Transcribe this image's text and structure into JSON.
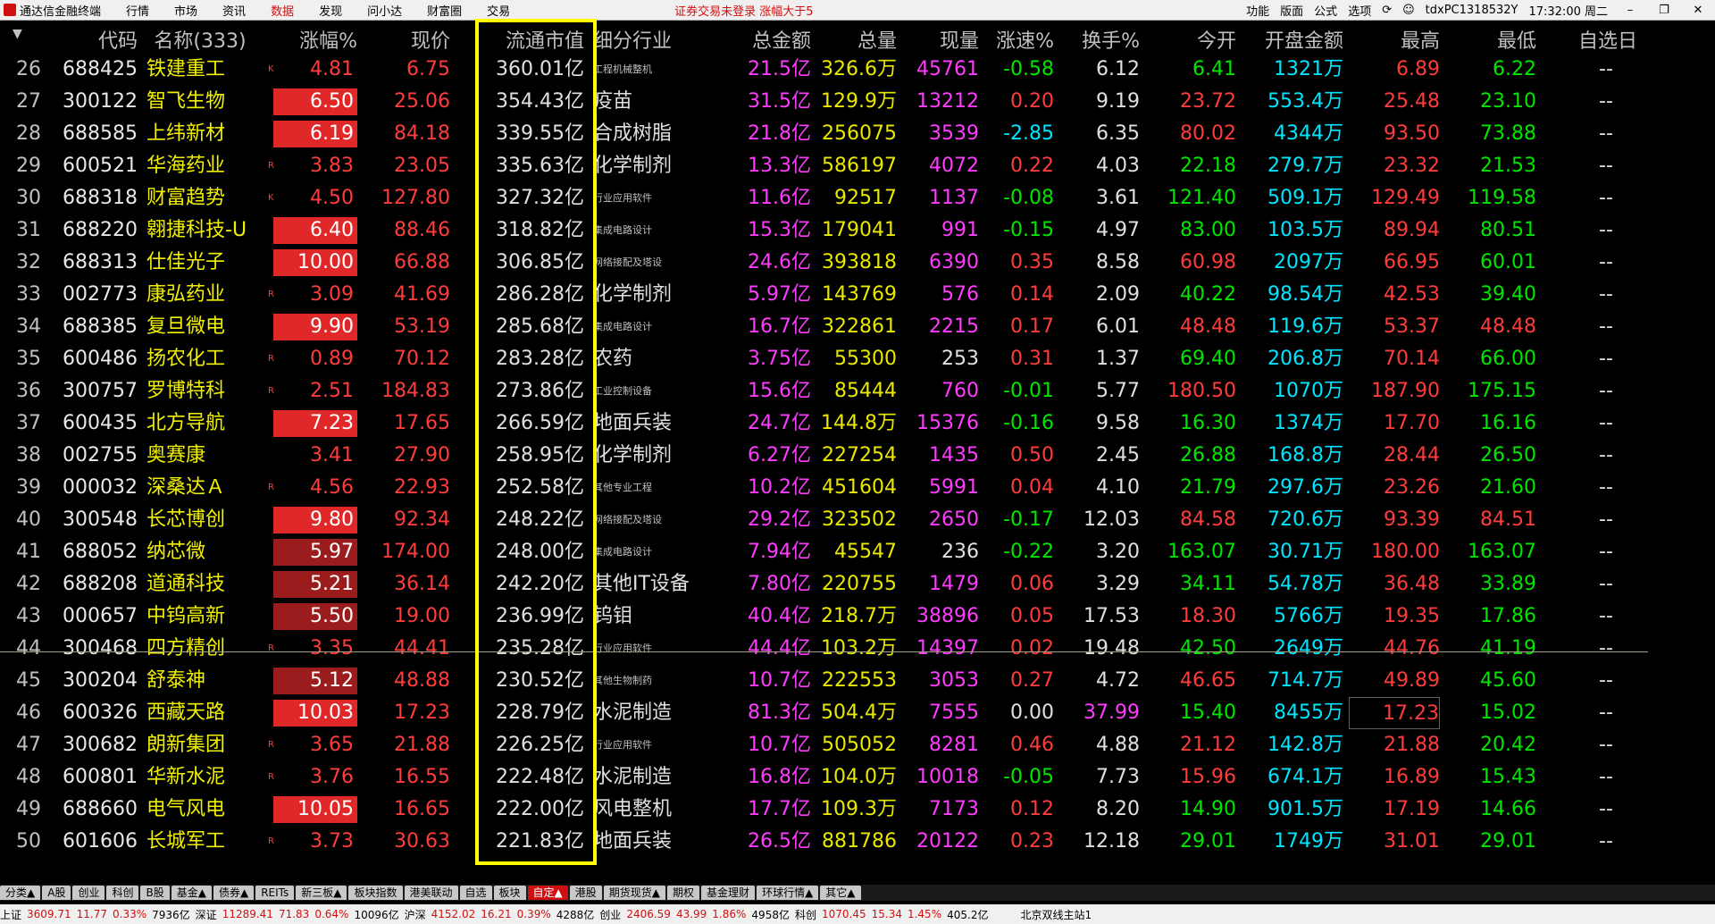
{
  "topbar": {
    "app_title": "通达信金融终端",
    "menus": [
      "行情",
      "市场",
      "资讯",
      "数据",
      "发现",
      "问小达",
      "财富圈",
      "交易"
    ],
    "active_menu": "数据",
    "notice": "证券交易未登录  涨幅大于5",
    "right_items": [
      "功能",
      "版面",
      "公式",
      "选项"
    ],
    "user": "tdxPC1318532Y",
    "time": "17:32:00 周二"
  },
  "headers": [
    "代码",
    "名称(333)",
    "涨幅%",
    "现价",
    "流通市值",
    "细分行业",
    "总金额",
    "总量",
    "现量",
    "涨速%",
    "换手%",
    "今开",
    "开盘金额",
    "最高",
    "最低",
    "自选日"
  ],
  "rows": [
    {
      "idx": "26",
      "code": "688425",
      "name": "铁建重工",
      "mark": "K",
      "pct": "4.81",
      "box": "",
      "price": "6.75",
      "cap": "360.01亿",
      "ind": "工程机械整机",
      "ind_small": true,
      "amt": "21.5亿",
      "vol": "326.6万",
      "cur": "45761",
      "curc": "magenta",
      "spd": "-0.58",
      "spdc": "green",
      "turn": "6.12",
      "open": "6.41",
      "openc": "green",
      "oamt": "1321万",
      "high": "6.89",
      "low": "6.22",
      "lowc": "green",
      "sel": "--"
    },
    {
      "idx": "27",
      "code": "300122",
      "name": "智飞生物",
      "mark": "",
      "pct": "6.50",
      "box": "bright",
      "price": "25.06",
      "cap": "354.43亿",
      "ind": "疫苗",
      "ind_small": false,
      "amt": "31.5亿",
      "vol": "129.9万",
      "cur": "13212",
      "curc": "magenta",
      "spd": "0.20",
      "spdc": "red",
      "turn": "9.19",
      "open": "23.72",
      "openc": "red",
      "oamt": "553.4万",
      "high": "25.48",
      "low": "23.10",
      "lowc": "green",
      "sel": "--"
    },
    {
      "idx": "28",
      "code": "688585",
      "name": "上纬新材",
      "mark": "",
      "pct": "6.19",
      "box": "bright",
      "price": "84.18",
      "cap": "339.55亿",
      "ind": "合成树脂",
      "ind_small": false,
      "amt": "21.8亿",
      "vol": "256075",
      "cur": "3539",
      "curc": "magenta",
      "spd": "-2.85",
      "spdc": "cyan",
      "turn": "6.35",
      "open": "80.02",
      "openc": "red",
      "oamt": "4344万",
      "high": "93.50",
      "low": "73.88",
      "lowc": "green",
      "sel": "--"
    },
    {
      "idx": "29",
      "code": "600521",
      "name": "华海药业",
      "mark": "R",
      "pct": "3.83",
      "box": "",
      "price": "23.05",
      "cap": "335.63亿",
      "ind": "化学制剂",
      "ind_small": false,
      "amt": "13.3亿",
      "vol": "586197",
      "cur": "4072",
      "curc": "magenta",
      "spd": "0.22",
      "spdc": "red",
      "turn": "4.03",
      "open": "22.18",
      "openc": "green",
      "oamt": "279.7万",
      "high": "23.32",
      "low": "21.53",
      "lowc": "green",
      "sel": "--"
    },
    {
      "idx": "30",
      "code": "688318",
      "name": "财富趋势",
      "mark": "K",
      "pct": "4.50",
      "box": "",
      "price": "127.80",
      "cap": "327.32亿",
      "ind": "行业应用软件",
      "ind_small": true,
      "amt": "11.6亿",
      "vol": "92517",
      "cur": "1137",
      "curc": "magenta",
      "spd": "-0.08",
      "spdc": "green",
      "turn": "3.61",
      "open": "121.40",
      "openc": "green",
      "oamt": "509.1万",
      "high": "129.49",
      "low": "119.58",
      "lowc": "green",
      "sel": "--"
    },
    {
      "idx": "31",
      "code": "688220",
      "name": "翱捷科技-U",
      "mark": "",
      "pct": "6.40",
      "box": "bright",
      "price": "88.46",
      "cap": "318.82亿",
      "ind": "集成电路设计",
      "ind_small": true,
      "amt": "15.3亿",
      "vol": "179041",
      "cur": "991",
      "curc": "magenta",
      "spd": "-0.15",
      "spdc": "green",
      "turn": "4.97",
      "open": "83.00",
      "openc": "green",
      "oamt": "103.5万",
      "high": "89.94",
      "low": "80.51",
      "lowc": "green",
      "sel": "--"
    },
    {
      "idx": "32",
      "code": "688313",
      "name": "仕佳光子",
      "mark": "",
      "pct": "10.00",
      "box": "bright",
      "price": "66.88",
      "cap": "306.85亿",
      "ind": "网络接配及塔设",
      "ind_small": true,
      "amt": "24.6亿",
      "vol": "393818",
      "cur": "6390",
      "curc": "magenta",
      "spd": "0.35",
      "spdc": "red",
      "turn": "8.58",
      "open": "60.98",
      "openc": "red",
      "oamt": "2097万",
      "high": "66.95",
      "low": "60.01",
      "lowc": "green",
      "sel": "--"
    },
    {
      "idx": "33",
      "code": "002773",
      "name": "康弘药业",
      "mark": "R",
      "pct": "3.09",
      "box": "",
      "price": "41.69",
      "cap": "286.28亿",
      "ind": "化学制剂",
      "ind_small": false,
      "amt": "5.97亿",
      "vol": "143769",
      "cur": "576",
      "curc": "magenta",
      "spd": "0.14",
      "spdc": "red",
      "turn": "2.09",
      "open": "40.22",
      "openc": "green",
      "oamt": "98.54万",
      "high": "42.53",
      "low": "39.40",
      "lowc": "green",
      "sel": "--"
    },
    {
      "idx": "34",
      "code": "688385",
      "name": "复旦微电",
      "mark": "",
      "pct": "9.90",
      "box": "bright",
      "price": "53.19",
      "cap": "285.68亿",
      "ind": "集成电路设计",
      "ind_small": true,
      "amt": "16.7亿",
      "vol": "322861",
      "cur": "2215",
      "curc": "magenta",
      "spd": "0.17",
      "spdc": "red",
      "turn": "6.01",
      "open": "48.48",
      "openc": "red",
      "oamt": "119.6万",
      "high": "53.37",
      "low": "48.48",
      "lowc": "red",
      "sel": "--"
    },
    {
      "idx": "35",
      "code": "600486",
      "name": "扬农化工",
      "mark": "R",
      "pct": "0.89",
      "box": "",
      "price": "70.12",
      "cap": "283.28亿",
      "ind": "农药",
      "ind_small": false,
      "amt": "3.75亿",
      "vol": "55300",
      "cur": "253",
      "curc": "white",
      "spd": "0.31",
      "spdc": "red",
      "turn": "1.37",
      "open": "69.40",
      "openc": "green",
      "oamt": "206.8万",
      "high": "70.14",
      "low": "66.00",
      "lowc": "green",
      "sel": "--"
    },
    {
      "idx": "36",
      "code": "300757",
      "name": "罗博特科",
      "mark": "R",
      "pct": "2.51",
      "box": "",
      "price": "184.83",
      "cap": "273.86亿",
      "ind": "工业控制设备",
      "ind_small": true,
      "amt": "15.6亿",
      "vol": "85444",
      "cur": "760",
      "curc": "magenta",
      "spd": "-0.01",
      "spdc": "green",
      "turn": "5.77",
      "open": "180.50",
      "openc": "red",
      "oamt": "1070万",
      "high": "187.90",
      "low": "175.15",
      "lowc": "green",
      "sel": "--"
    },
    {
      "idx": "37",
      "code": "600435",
      "name": "北方导航",
      "mark": "",
      "pct": "7.23",
      "box": "bright",
      "price": "17.65",
      "cap": "266.59亿",
      "ind": "地面兵装",
      "ind_small": false,
      "amt": "24.7亿",
      "vol": "144.8万",
      "cur": "15376",
      "curc": "magenta",
      "spd": "-0.16",
      "spdc": "green",
      "turn": "9.58",
      "open": "16.30",
      "openc": "green",
      "oamt": "1374万",
      "high": "17.70",
      "low": "16.16",
      "lowc": "green",
      "sel": "--"
    },
    {
      "idx": "38",
      "code": "002755",
      "name": "奥赛康",
      "mark": "",
      "pct": "3.41",
      "box": "",
      "price": "27.90",
      "cap": "258.95亿",
      "ind": "化学制剂",
      "ind_small": false,
      "amt": "6.27亿",
      "vol": "227254",
      "cur": "1435",
      "curc": "magenta",
      "spd": "0.50",
      "spdc": "red",
      "turn": "2.45",
      "open": "26.88",
      "openc": "green",
      "oamt": "168.8万",
      "high": "28.44",
      "low": "26.50",
      "lowc": "green",
      "sel": "--"
    },
    {
      "idx": "39",
      "code": "000032",
      "name": "深桑达Ａ",
      "mark": "R",
      "pct": "4.56",
      "box": "",
      "price": "22.93",
      "cap": "252.58亿",
      "ind": "其他专业工程",
      "ind_small": true,
      "amt": "10.2亿",
      "vol": "451604",
      "cur": "5991",
      "curc": "magenta",
      "spd": "0.04",
      "spdc": "red",
      "turn": "4.10",
      "open": "21.79",
      "openc": "green",
      "oamt": "297.6万",
      "high": "23.26",
      "low": "21.60",
      "lowc": "green",
      "sel": "--"
    },
    {
      "idx": "40",
      "code": "300548",
      "name": "长芯博创",
      "mark": "",
      "pct": "9.80",
      "box": "bright",
      "price": "92.34",
      "cap": "248.22亿",
      "ind": "网络接配及塔设",
      "ind_small": true,
      "amt": "29.2亿",
      "vol": "323502",
      "cur": "2650",
      "curc": "magenta",
      "spd": "-0.17",
      "spdc": "green",
      "turn": "12.03",
      "open": "84.58",
      "openc": "red",
      "oamt": "720.6万",
      "high": "93.39",
      "low": "84.51",
      "lowc": "red",
      "sel": "--"
    },
    {
      "idx": "41",
      "code": "688052",
      "name": "纳芯微",
      "mark": "",
      "pct": "5.97",
      "box": "dark",
      "price": "174.00",
      "cap": "248.00亿",
      "ind": "集成电路设计",
      "ind_small": true,
      "amt": "7.94亿",
      "vol": "45547",
      "cur": "236",
      "curc": "white",
      "spd": "-0.22",
      "spdc": "green",
      "turn": "3.20",
      "open": "163.07",
      "openc": "green",
      "oamt": "30.71万",
      "high": "180.00",
      "low": "163.07",
      "lowc": "green",
      "sel": "--"
    },
    {
      "idx": "42",
      "code": "688208",
      "name": "道通科技",
      "mark": "",
      "pct": "5.21",
      "box": "dark",
      "price": "36.14",
      "cap": "242.20亿",
      "ind": "其他IT设备",
      "ind_small": false,
      "amt": "7.80亿",
      "vol": "220755",
      "cur": "1479",
      "curc": "magenta",
      "spd": "0.06",
      "spdc": "red",
      "turn": "3.29",
      "open": "34.11",
      "openc": "green",
      "oamt": "54.78万",
      "high": "36.48",
      "low": "33.89",
      "lowc": "green",
      "sel": "--"
    },
    {
      "idx": "43",
      "code": "000657",
      "name": "中钨高新",
      "mark": "",
      "pct": "5.50",
      "box": "dark",
      "price": "19.00",
      "cap": "236.99亿",
      "ind": "钨钼",
      "ind_small": false,
      "amt": "40.4亿",
      "vol": "218.7万",
      "cur": "38896",
      "curc": "magenta",
      "spd": "0.05",
      "spdc": "red",
      "turn": "17.53",
      "open": "18.30",
      "openc": "red",
      "oamt": "5766万",
      "high": "19.35",
      "low": "17.86",
      "lowc": "green",
      "sel": "--"
    },
    {
      "idx": "44",
      "code": "300468",
      "name": "四方精创",
      "mark": "R",
      "pct": "3.35",
      "box": "",
      "price": "44.41",
      "cap": "235.28亿",
      "ind": "行业应用软件",
      "ind_small": true,
      "amt": "44.4亿",
      "vol": "103.2万",
      "cur": "14397",
      "curc": "magenta",
      "spd": "0.02",
      "spdc": "red",
      "turn": "19.48",
      "open": "42.50",
      "openc": "green",
      "oamt": "2649万",
      "high": "44.76",
      "low": "41.19",
      "lowc": "green",
      "sel": "--"
    },
    {
      "idx": "45",
      "code": "300204",
      "name": "舒泰神",
      "mark": "",
      "pct": "5.12",
      "box": "dark",
      "price": "48.88",
      "cap": "230.52亿",
      "ind": "其他生物制药",
      "ind_small": true,
      "amt": "10.7亿",
      "vol": "222553",
      "cur": "3053",
      "curc": "magenta",
      "spd": "0.27",
      "spdc": "red",
      "turn": "4.72",
      "open": "46.65",
      "openc": "red",
      "oamt": "714.7万",
      "high": "49.89",
      "low": "45.60",
      "lowc": "green",
      "sel": "--"
    },
    {
      "idx": "46",
      "code": "600326",
      "name": "西藏天路",
      "mark": "",
      "pct": "10.03",
      "box": "bright",
      "price": "17.23",
      "cap": "228.79亿",
      "ind": "水泥制造",
      "ind_small": false,
      "amt": "81.3亿",
      "vol": "504.4万",
      "cur": "7555",
      "curc": "magenta",
      "spd": "0.00",
      "spdc": "white",
      "turn": "37.99",
      "turnc": "magenta",
      "open": "15.40",
      "openc": "green",
      "oamt": "8455万",
      "high": "17.23",
      "low": "15.02",
      "lowc": "green",
      "sel": "--",
      "highbox": true
    },
    {
      "idx": "47",
      "code": "300682",
      "name": "朗新集团",
      "mark": "R",
      "pct": "3.65",
      "box": "",
      "price": "21.88",
      "cap": "226.25亿",
      "ind": "行业应用软件",
      "ind_small": true,
      "amt": "10.7亿",
      "vol": "505052",
      "cur": "8281",
      "curc": "magenta",
      "spd": "0.46",
      "spdc": "red",
      "turn": "4.88",
      "open": "21.12",
      "openc": "red",
      "oamt": "142.8万",
      "high": "21.88",
      "low": "20.42",
      "lowc": "green",
      "sel": "--"
    },
    {
      "idx": "48",
      "code": "600801",
      "name": "华新水泥",
      "mark": "R",
      "pct": "3.76",
      "box": "",
      "price": "16.55",
      "cap": "222.48亿",
      "ind": "水泥制造",
      "ind_small": false,
      "amt": "16.8亿",
      "vol": "104.0万",
      "cur": "10018",
      "curc": "magenta",
      "spd": "-0.05",
      "spdc": "green",
      "turn": "7.73",
      "open": "15.96",
      "openc": "red",
      "oamt": "674.1万",
      "high": "16.89",
      "low": "15.43",
      "lowc": "green",
      "sel": "--"
    },
    {
      "idx": "49",
      "code": "688660",
      "name": "电气风电",
      "mark": "",
      "pct": "10.05",
      "box": "bright",
      "price": "16.65",
      "cap": "222.00亿",
      "ind": "风电整机",
      "ind_small": false,
      "amt": "17.7亿",
      "vol": "109.3万",
      "cur": "7173",
      "curc": "magenta",
      "spd": "0.12",
      "spdc": "red",
      "turn": "8.20",
      "open": "14.90",
      "openc": "green",
      "oamt": "901.5万",
      "high": "17.19",
      "low": "14.66",
      "lowc": "green",
      "sel": "--"
    },
    {
      "idx": "50",
      "code": "601606",
      "name": "长城军工",
      "mark": "R",
      "pct": "3.73",
      "box": "",
      "price": "30.63",
      "cap": "221.83亿",
      "ind": "地面兵装",
      "ind_small": false,
      "amt": "26.5亿",
      "vol": "881786",
      "cur": "20122",
      "curc": "magenta",
      "spd": "0.23",
      "spdc": "red",
      "turn": "12.18",
      "open": "29.01",
      "openc": "green",
      "oamt": "1749万",
      "high": "31.01",
      "low": "29.01",
      "lowc": "green",
      "sel": "--"
    }
  ],
  "tabs": [
    "分类▲",
    "A股",
    "创业",
    "科创",
    "B股",
    "基金▲",
    "债券▲",
    "REITs",
    "新三板▲",
    "板块指数",
    "港美联动",
    "自选",
    "板块",
    "自定▲",
    "港股",
    "期货现货▲",
    "期权",
    "基金理财",
    "环球行情▲",
    "其它▲"
  ],
  "active_tab": "自定▲",
  "status": {
    "sh_label": "上证",
    "sh_val": "3609.71",
    "sh_chg": "11.77",
    "sh_pct": "0.33%",
    "sh_amt": "7936亿",
    "sz_label": "深证",
    "sz_val": "11289.41",
    "sz_chg": "71.83",
    "sz_pct": "0.64%",
    "sz_amt": "10096亿",
    "hs_label": "沪深",
    "hs_val": "4152.02",
    "hs_chg": "16.21",
    "hs_pct": "0.39%",
    "hs_amt": "4288亿",
    "cy_label": "创业",
    "cy_val": "2406.59",
    "cy_chg": "43.99",
    "cy_pct": "1.86%",
    "cy_amt": "4958亿",
    "kc_label": "科创",
    "kc_val": "1070.45",
    "kc_chg": "15.34",
    "kc_pct": "1.45%",
    "kc_amt": "405.2亿",
    "server": "北京双线主站1"
  },
  "colors": {
    "up": "#ff3c3c",
    "down": "#00e600",
    "highlight": "#ffff00",
    "bright_box": "#e02828",
    "dark_box": "#9a1c1c"
  }
}
